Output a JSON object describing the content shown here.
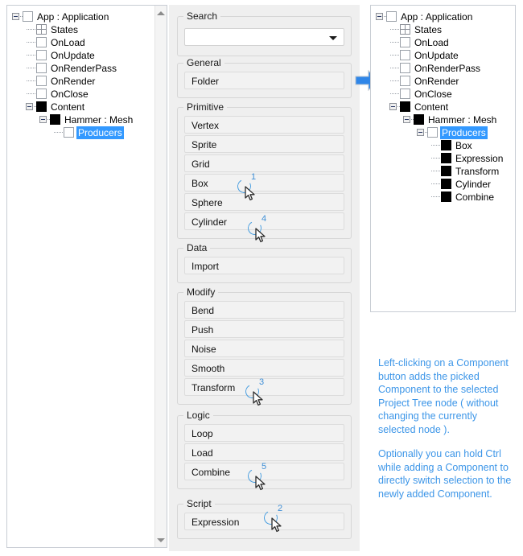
{
  "left_tree": {
    "name": "project-tree-before",
    "nodes": [
      {
        "label": "App : Application",
        "depth": 0,
        "icon": "blank-swatch",
        "expander": "minus",
        "selected": false
      },
      {
        "label": "States",
        "depth": 1,
        "icon": "grid-swatch",
        "expander": "none",
        "selected": false
      },
      {
        "label": "OnLoad",
        "depth": 1,
        "icon": "blank-swatch",
        "expander": "none",
        "selected": false
      },
      {
        "label": "OnUpdate",
        "depth": 1,
        "icon": "blank-swatch",
        "expander": "none",
        "selected": false
      },
      {
        "label": "OnRenderPass",
        "depth": 1,
        "icon": "blank-swatch",
        "expander": "none",
        "selected": false
      },
      {
        "label": "OnRender",
        "depth": 1,
        "icon": "blank-swatch",
        "expander": "none",
        "selected": false
      },
      {
        "label": "OnClose",
        "depth": 1,
        "icon": "blank-swatch",
        "expander": "none",
        "selected": false
      },
      {
        "label": "Content",
        "depth": 1,
        "icon": "black-swatch",
        "expander": "minus",
        "selected": false
      },
      {
        "label": "Hammer : Mesh",
        "depth": 2,
        "icon": "black-swatch",
        "expander": "minus",
        "selected": false
      },
      {
        "label": "Producers",
        "depth": 3,
        "icon": "blank-swatch",
        "expander": "none",
        "selected": true
      }
    ],
    "scrollbar": {
      "up_icon": "scroll-up-arrow-icon",
      "down_icon": "scroll-down-arrow-icon"
    }
  },
  "right_tree": {
    "name": "project-tree-after",
    "nodes": [
      {
        "label": "App : Application",
        "depth": 0,
        "icon": "blank-swatch",
        "expander": "minus",
        "selected": false
      },
      {
        "label": "States",
        "depth": 1,
        "icon": "grid-swatch",
        "expander": "none",
        "selected": false
      },
      {
        "label": "OnLoad",
        "depth": 1,
        "icon": "blank-swatch",
        "expander": "none",
        "selected": false
      },
      {
        "label": "OnUpdate",
        "depth": 1,
        "icon": "blank-swatch",
        "expander": "none",
        "selected": false
      },
      {
        "label": "OnRenderPass",
        "depth": 1,
        "icon": "blank-swatch",
        "expander": "none",
        "selected": false
      },
      {
        "label": "OnRender",
        "depth": 1,
        "icon": "blank-swatch",
        "expander": "none",
        "selected": false
      },
      {
        "label": "OnClose",
        "depth": 1,
        "icon": "blank-swatch",
        "expander": "none",
        "selected": false
      },
      {
        "label": "Content",
        "depth": 1,
        "icon": "black-swatch",
        "expander": "minus",
        "selected": false
      },
      {
        "label": "Hammer : Mesh",
        "depth": 2,
        "icon": "black-swatch",
        "expander": "minus",
        "selected": false
      },
      {
        "label": "Producers",
        "depth": 3,
        "icon": "blank-swatch",
        "expander": "minus",
        "selected": true
      },
      {
        "label": "Box",
        "depth": 4,
        "icon": "black-swatch",
        "expander": "none",
        "selected": false
      },
      {
        "label": "Expression",
        "depth": 4,
        "icon": "black-swatch",
        "expander": "none",
        "selected": false
      },
      {
        "label": "Transform",
        "depth": 4,
        "icon": "black-swatch",
        "expander": "none",
        "selected": false
      },
      {
        "label": "Cylinder",
        "depth": 4,
        "icon": "black-swatch",
        "expander": "none",
        "selected": false
      },
      {
        "label": "Combine",
        "depth": 4,
        "icon": "black-swatch",
        "expander": "none",
        "selected": false
      }
    ]
  },
  "flow_arrow": {
    "icon": "right-arrow-icon",
    "color": "#2f86e8"
  },
  "palette": {
    "search": {
      "group_label": "Search",
      "value": "",
      "placeholder": "",
      "caret_icon": "chevron-down-icon"
    },
    "groups": [
      {
        "label": "General",
        "buttons": [
          "Folder"
        ]
      },
      {
        "label": "Primitive",
        "buttons": [
          "Vertex",
          "Sprite",
          "Grid",
          "Box",
          "Sphere",
          "Cylinder"
        ]
      },
      {
        "label": "Data",
        "buttons": [
          "Import"
        ]
      },
      {
        "label": "Modify",
        "buttons": [
          "Bend",
          "Push",
          "Noise",
          "Smooth",
          "Transform"
        ]
      },
      {
        "label": "Logic",
        "buttons": [
          "Loop",
          "Load",
          "Combine"
        ]
      },
      {
        "label": "Script",
        "buttons": [
          "Expression"
        ]
      }
    ]
  },
  "click_markers": [
    {
      "number": "1",
      "target": "Box"
    },
    {
      "number": "4",
      "target": "Cylinder"
    },
    {
      "number": "3",
      "target": "Transform"
    },
    {
      "number": "5",
      "target": "Combine"
    },
    {
      "number": "2",
      "target": "Expression"
    }
  ],
  "notes": {
    "color": "#3d96e8",
    "paragraphs": [
      "Left-clicking on a Component button adds the picked Component to the selected Project Tree node ( without changing the currently selected node ).",
      "Optionally you can hold Ctrl while adding a Component to directly switch selection to the newly added Component."
    ]
  }
}
